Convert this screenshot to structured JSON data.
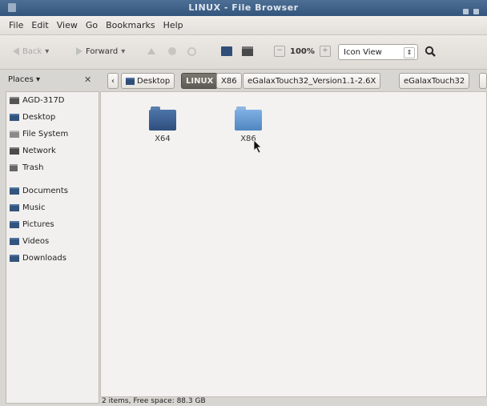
{
  "window": {
    "title": "LINUX - File Browser"
  },
  "menu": [
    "File",
    "Edit",
    "View",
    "Go",
    "Bookmarks",
    "Help"
  ],
  "toolbar": {
    "back_label": "Back",
    "forward_label": "Forward",
    "zoom_level": "100%",
    "view_mode": "Icon View"
  },
  "places": {
    "header": "Places",
    "close_glyph": "✕"
  },
  "breadcrumbs": [
    "Desktop",
    "LINUX",
    "X86",
    "eGalaxTouch32_Version1.1-2.6X",
    "eGalaxTouch32"
  ],
  "sidebar": {
    "devices": [
      {
        "label": "AGD-317D",
        "icon": "drive-icon"
      },
      {
        "label": "Desktop",
        "icon": "folder-icon"
      },
      {
        "label": "File System",
        "icon": "filesystem-icon"
      },
      {
        "label": "Network",
        "icon": "network-icon"
      },
      {
        "label": "Trash",
        "icon": "trash-icon"
      }
    ],
    "bookmarks": [
      {
        "label": "Documents",
        "icon": "folder-icon"
      },
      {
        "label": "Music",
        "icon": "folder-icon"
      },
      {
        "label": "Pictures",
        "icon": "folder-icon"
      },
      {
        "label": "Videos",
        "icon": "folder-icon"
      },
      {
        "label": "Downloads",
        "icon": "folder-icon"
      }
    ]
  },
  "files": [
    {
      "name": "X64",
      "icon": "folder-icon"
    },
    {
      "name": "X86",
      "icon": "folder-icon"
    }
  ],
  "status": {
    "text": "2 items, Free space: 88.3 GB"
  },
  "colors": {
    "titlebar": "#34557b",
    "folder": "#2f4f7d",
    "active_crumb": "#5e5a55"
  }
}
